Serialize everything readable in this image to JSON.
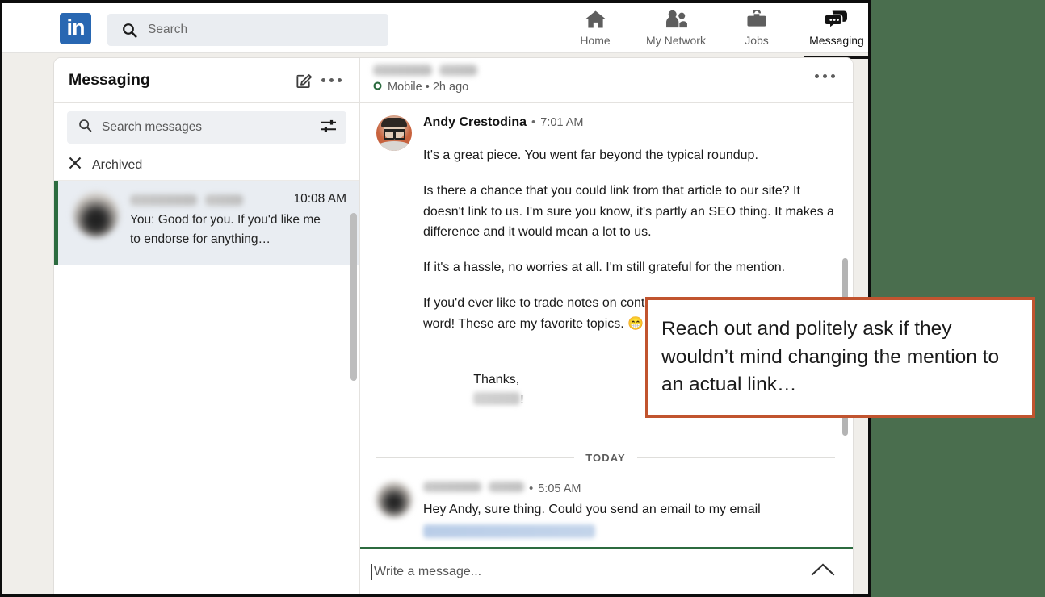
{
  "globalnav": {
    "logo_text": "in",
    "search": {
      "placeholder": "Search",
      "value": ""
    },
    "items": [
      {
        "label": "Home",
        "icon": "home-icon",
        "active": false
      },
      {
        "label": "My Network",
        "icon": "my-network-icon",
        "active": false
      },
      {
        "label": "Jobs",
        "icon": "jobs-icon",
        "active": false
      },
      {
        "label": "Messaging",
        "icon": "messaging-icon",
        "active": true
      }
    ]
  },
  "left_pane": {
    "title": "Messaging",
    "compose_icon": "compose-pencil-icon",
    "more_icon": "more-options-icon",
    "search": {
      "placeholder": "Search messages",
      "value": "",
      "icon": "search-icon",
      "filter_icon": "filter-sliders-icon"
    },
    "archived": {
      "label": "Archived",
      "icon": "close-x-icon"
    },
    "conversations": [
      {
        "name_redacted": true,
        "time": "10:08 AM",
        "snippet": "You: Good for you. If you'd like me to endorse for anything…",
        "selected": true
      }
    ]
  },
  "conversation_header": {
    "name_redacted": true,
    "status_icon": "mobile-presence-icon",
    "status_text": "Mobile • 2h ago",
    "more_icon": "more-options-icon"
  },
  "thread": {
    "messages": [
      {
        "author": "Andy Crestodina",
        "separator": "•",
        "time": "7:01 AM",
        "avatar": "avatar-andy-crestodina",
        "paragraphs": [
          "It's a great piece. You went far beyond the typical roundup.",
          "Is there a chance that you could link from that article to our site? It doesn't link to us. I'm sure you know, it's partly an SEO thing. It makes a difference and it would mean a lot to us.",
          "If it's a hassle, no worries at all. I'm still grateful for the mention.",
          "If you'd ever like to trade notes on content or YouTube, just say the word! These are my favorite topics. 😁",
          "Thanks,"
        ],
        "signoff_suffix": "!"
      }
    ],
    "day_divider": "TODAY",
    "reply": {
      "author_redacted": true,
      "separator": "•",
      "time": "5:05 AM",
      "avatar": "avatar-redacted",
      "text": "Hey Andy, sure thing. Could you send an email to my email",
      "link_redacted": true
    }
  },
  "composer": {
    "placeholder": "Write a message...",
    "value": "",
    "expand_icon": "chevron-up-icon"
  },
  "callout": {
    "text": "Reach out and politely ask if they wouldn’t mind changing the mention to an actual link…",
    "border_color": "#c1542f"
  },
  "colors": {
    "page_background": "#4a6e4e",
    "app_background": "#f0eeea",
    "linkedin_blue": "#2867b2",
    "selected_accent": "#2c6b3f",
    "callout_border": "#c1542f"
  }
}
